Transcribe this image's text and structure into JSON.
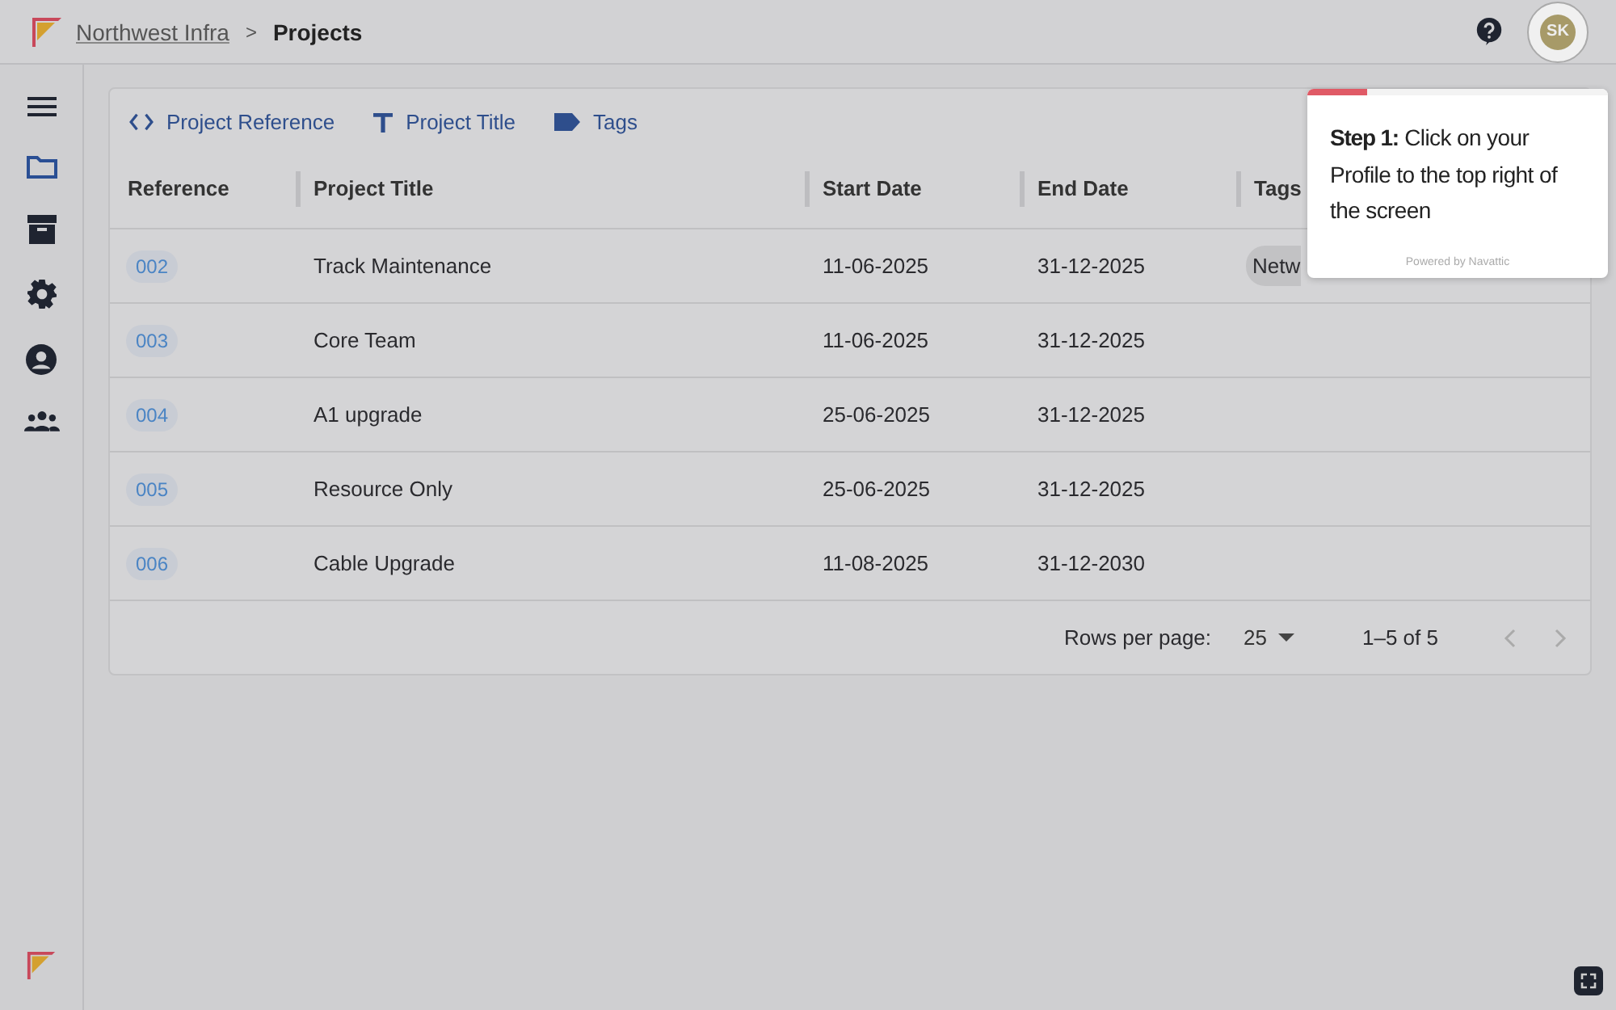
{
  "breadcrumb": [
    {
      "label": "Northwest Infra",
      "link": true
    },
    {
      "label": "Projects",
      "link": false
    }
  ],
  "breadcrumb_separator": ">",
  "avatar": {
    "initials": "SK"
  },
  "sidebar": {
    "items": [
      {
        "kind": "folder",
        "selected": true
      },
      {
        "kind": "archive",
        "selected": false
      },
      {
        "kind": "gear",
        "selected": false
      },
      {
        "kind": "person",
        "selected": false
      },
      {
        "kind": "group",
        "selected": false
      }
    ]
  },
  "toolbar": [
    {
      "kind": "code",
      "label": "Project Reference"
    },
    {
      "kind": "text",
      "label": "Project Title"
    },
    {
      "kind": "tag",
      "label": "Tags"
    }
  ],
  "table": {
    "columns": [
      "Reference",
      "Project Title",
      "Start Date",
      "End Date",
      "Tags"
    ],
    "rows": [
      {
        "reference": "002",
        "title": "Track Maintenance",
        "start": "11-06-2025",
        "end": "31-12-2025",
        "tags": [
          "Netw"
        ]
      },
      {
        "reference": "003",
        "title": "Core Team",
        "start": "11-06-2025",
        "end": "31-12-2025",
        "tags": []
      },
      {
        "reference": "004",
        "title": "A1 upgrade",
        "start": "25-06-2025",
        "end": "31-12-2025",
        "tags": []
      },
      {
        "reference": "005",
        "title": "Resource Only",
        "start": "25-06-2025",
        "end": "31-12-2025",
        "tags": []
      },
      {
        "reference": "006",
        "title": "Cable Upgrade",
        "start": "11-08-2025",
        "end": "31-12-2030",
        "tags": []
      }
    ]
  },
  "pagination": {
    "rows_per_page_label": "Rows per page:",
    "rows_per_page": "25",
    "range": "1–5 of 5",
    "prev_disabled": true,
    "next_disabled": true
  },
  "tooltip": {
    "step": "Step 1:",
    "text": "Click on your Profile to the top right of the screen",
    "footer": "Powered by Navattic",
    "level": 0.2
  }
}
